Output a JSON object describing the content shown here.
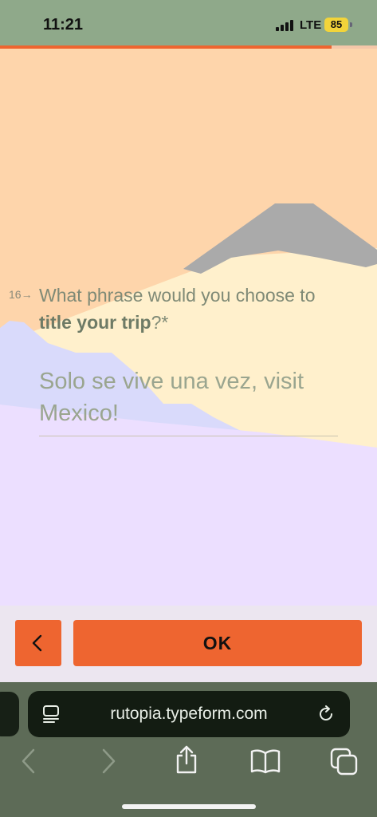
{
  "status_bar": {
    "time": "11:21",
    "network": "LTE",
    "battery": "85"
  },
  "form": {
    "progress_fraction": 0.88,
    "question_number": "16",
    "question_prefix": "What phrase would you choose to ",
    "question_bold": "title your trip",
    "question_suffix": "?*",
    "answer_value": "Solo se vive una vez, visit Mexico!"
  },
  "navigation": {
    "ok_label": "OK"
  },
  "browser": {
    "url": "rutopia.typeform.com"
  },
  "colors": {
    "accent": "#ee6530",
    "status_bar": "#8fa98a",
    "background": "#fed5ab",
    "browser_chrome": "#5d6b57"
  },
  "icons": {
    "back_button": "chevron-left-icon",
    "reader": "reader-mode-icon",
    "reload": "reload-icon",
    "toolbar": [
      "back-arrow-icon",
      "forward-arrow-icon",
      "share-icon",
      "bookmarks-icon",
      "tabs-icon"
    ]
  }
}
